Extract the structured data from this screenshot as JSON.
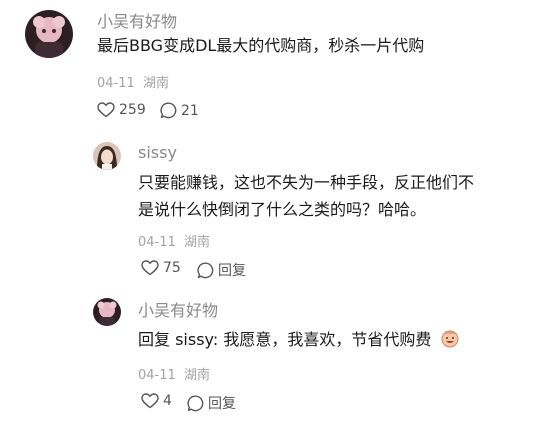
{
  "comments": [
    {
      "username": "小吴有好物",
      "text": "最后BBG变成DL最大的代购商，秒杀一片代购",
      "date": "04-11",
      "location": "湖南",
      "likes": "259",
      "replies": "21"
    }
  ],
  "replies": [
    {
      "username": "sissy",
      "text": "只要能赚钱，这也不失为一种手段，反正他们不是说什么快倒闭了什么之类的吗？哈哈。",
      "date": "04-11",
      "location": "湖南",
      "likes": "75",
      "reply_label": "回复"
    },
    {
      "username": "小吴有好物",
      "text_prefix": "回复 sissy: ",
      "text": "我愿意，我喜欢，节省代购费",
      "date": "04-11",
      "location": "湖南",
      "likes": "4",
      "reply_label": "回复"
    }
  ],
  "icons": {
    "like": "heart-outline-icon",
    "comment": "speech-bubble-icon",
    "emoji": "grinning-face-emoji"
  },
  "colors": {
    "text": "#1a1a1a",
    "username": "#8a8a8a",
    "meta": "#a3a3a3",
    "icon": "#555555"
  }
}
